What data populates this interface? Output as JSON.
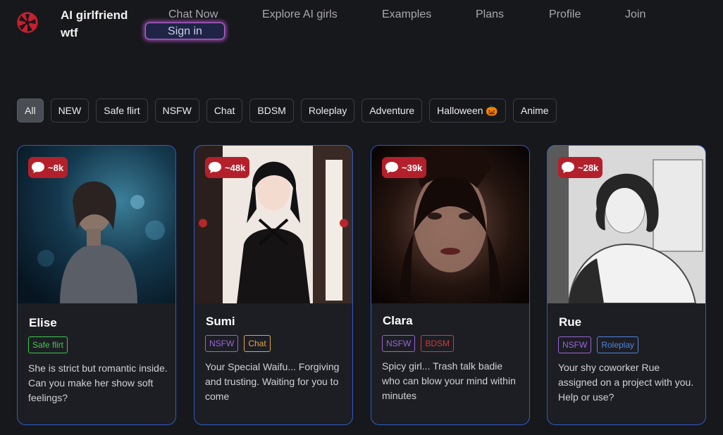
{
  "brand": {
    "name": "AI girlfriend wtf",
    "logo_icon": "film-reel-icon"
  },
  "nav": {
    "items": [
      "Chat Now",
      "Explore AI girls",
      "Examples",
      "Plans",
      "Profile",
      "Join"
    ],
    "sign_in": "Sign in"
  },
  "filters": [
    {
      "label": "All",
      "active": true
    },
    {
      "label": "NEW"
    },
    {
      "label": "Safe flirt"
    },
    {
      "label": "NSFW"
    },
    {
      "label": "Chat"
    },
    {
      "label": "BDSM"
    },
    {
      "label": "Roleplay"
    },
    {
      "label": "Adventure"
    },
    {
      "label": "Halloween 🎃"
    },
    {
      "label": "Anime"
    }
  ],
  "cards": [
    {
      "name": "Elise",
      "count": "~8k",
      "tags": [
        {
          "label": "Safe flirt",
          "color": "#3fc94a"
        }
      ],
      "description": "She is strict but romantic inside. Can you make her show soft feelings?"
    },
    {
      "name": "Sumi",
      "count": "~48k",
      "tags": [
        {
          "label": "NSFW",
          "color": "#9a64d8"
        },
        {
          "label": "Chat",
          "color": "#e3a34d"
        }
      ],
      "description": "Your Special Waifu... Forgiving and trusting. Waiting for you to come"
    },
    {
      "name": "Clara",
      "count": "~39k",
      "tags": [
        {
          "label": "NSFW",
          "color": "#9a64d8"
        },
        {
          "label": "BDSM",
          "color": "#cf3b36"
        }
      ],
      "description": "Spicy girl... Trash talk badie who can blow your mind within minutes"
    },
    {
      "name": "Rue",
      "count": "~28k",
      "tags": [
        {
          "label": "NSFW",
          "color": "#9a64d8"
        },
        {
          "label": "Roleplay",
          "color": "#4f84e0"
        }
      ],
      "description": "Your shy coworker Rue assigned on a project with you. Help or use?"
    }
  ],
  "colors": {
    "background": "#17181c",
    "card_border": "#2f5bc9",
    "badge": "#b3202b",
    "sign_in_glow": "#ce5ce6"
  },
  "icons": {
    "chat_count": "chat-bubble-icon"
  }
}
